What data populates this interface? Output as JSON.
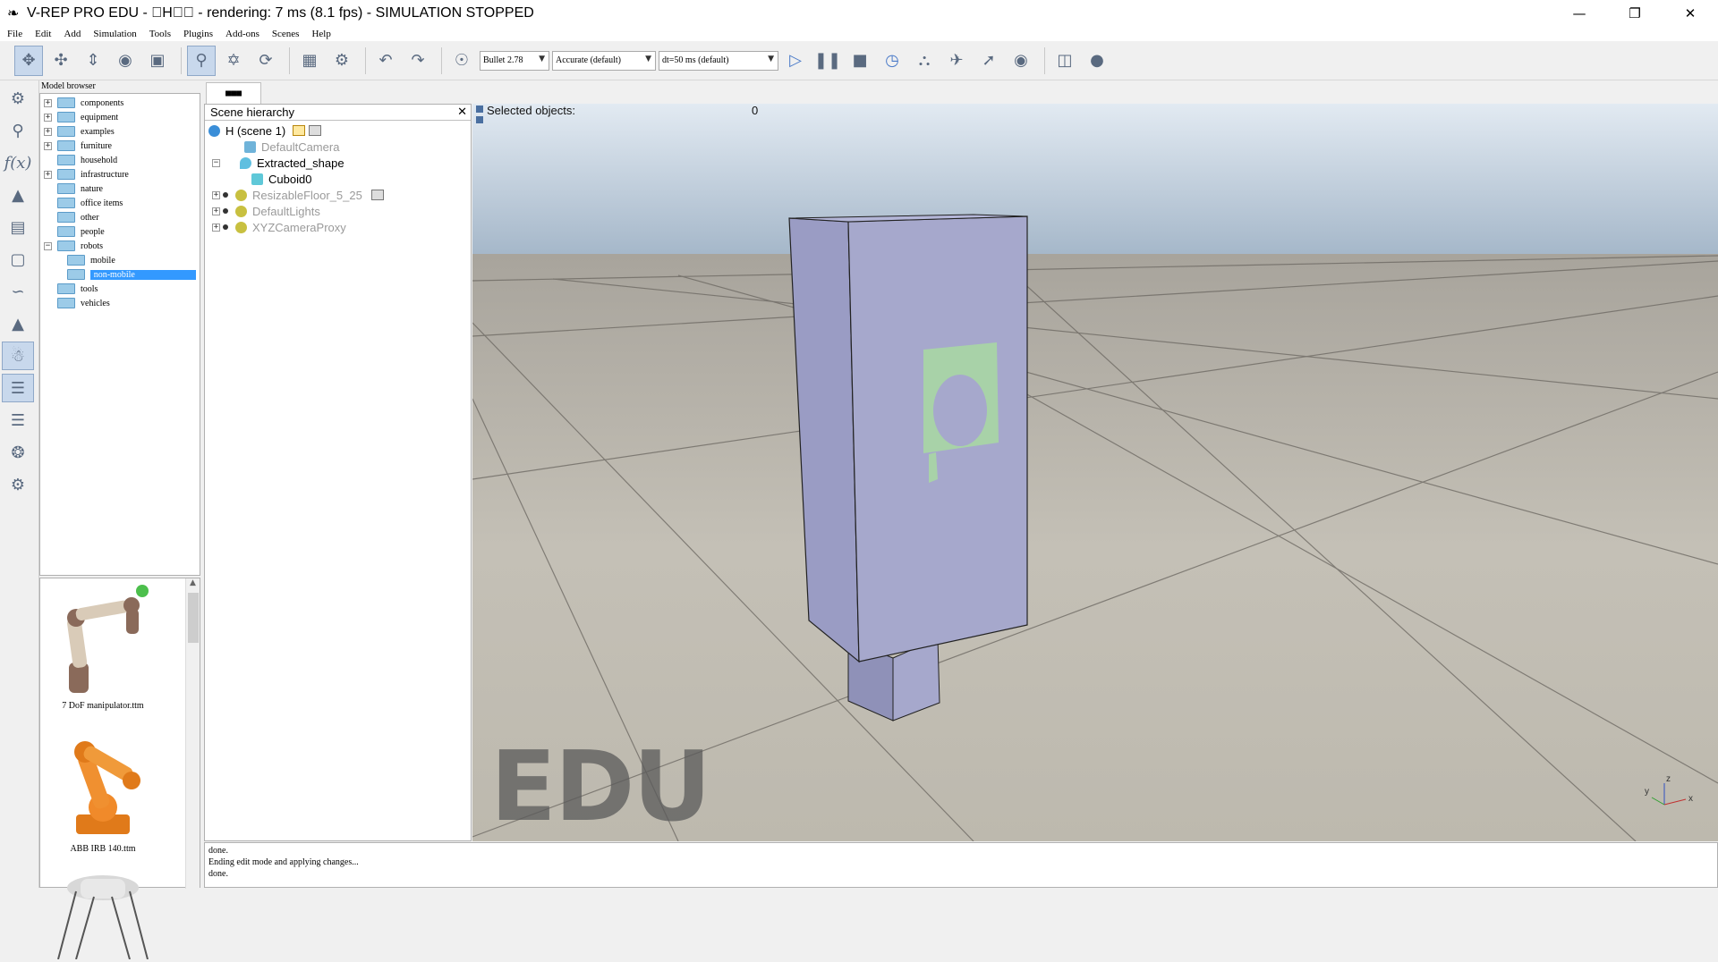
{
  "window": {
    "title": "V-REP PRO EDU - \u0000H\u0000\u0000 - rendering: 7 ms (8.1 fps) - SIMULATION STOPPED",
    "min_icon": "minimize-icon",
    "max_icon": "maximize-icon",
    "close_icon": "close-icon"
  },
  "menu": [
    "File",
    "Edit",
    "Add",
    "Simulation",
    "Tools",
    "Plugins",
    "Add-ons",
    "Scenes",
    "Help"
  ],
  "toolbar": {
    "engine": "Bullet 2.78",
    "accuracy": "Accurate (default)",
    "timestep": "dt=50 ms (default)"
  },
  "model_browser": {
    "title": "Model browser",
    "items": [
      {
        "label": "components",
        "expandable": true,
        "depth": 0
      },
      {
        "label": "equipment",
        "expandable": true,
        "depth": 0
      },
      {
        "label": "examples",
        "expandable": true,
        "depth": 0
      },
      {
        "label": "furniture",
        "expandable": true,
        "depth": 0
      },
      {
        "label": "household",
        "expandable": false,
        "depth": 0
      },
      {
        "label": "infrastructure",
        "expandable": true,
        "depth": 0
      },
      {
        "label": "nature",
        "expandable": false,
        "depth": 0
      },
      {
        "label": "office items",
        "expandable": false,
        "depth": 0
      },
      {
        "label": "other",
        "expandable": false,
        "depth": 0
      },
      {
        "label": "people",
        "expandable": false,
        "depth": 0
      },
      {
        "label": "robots",
        "expandable": true,
        "depth": 0
      },
      {
        "label": "mobile",
        "expandable": false,
        "depth": 1
      },
      {
        "label": "non-mobile",
        "expandable": false,
        "depth": 1
      },
      {
        "label": "tools",
        "expandable": false,
        "depth": 0
      },
      {
        "label": "vehicles",
        "expandable": false,
        "depth": 0
      }
    ],
    "thumbnails": [
      {
        "label": "7 DoF manipulator.ttm"
      },
      {
        "label": "ABB IRB 140.ttm"
      },
      {
        "label": ""
      }
    ]
  },
  "scene_tab": "■■■",
  "hierarchy": {
    "title": "Scene hierarchy",
    "rows": [
      {
        "label": "H (scene 1)",
        "dim": false
      },
      {
        "label": "DefaultCamera",
        "dim": true
      },
      {
        "label": "Extracted_shape",
        "dim": false
      },
      {
        "label": "Cuboid0",
        "dim": false
      },
      {
        "label": "ResizableFloor_5_25",
        "dim": true
      },
      {
        "label": "DefaultLights",
        "dim": true
      },
      {
        "label": "XYZCameraProxy",
        "dim": true
      }
    ]
  },
  "viewport": {
    "selected_label": "Selected objects:",
    "selected_count": "0",
    "watermark": "EDU",
    "axis_x": "x",
    "axis_y": "y",
    "axis_z": "z"
  },
  "console": [
    "done.",
    "Ending edit mode and applying changes...",
    "done."
  ],
  "colors": {
    "shape": "#a6a8cc",
    "shape_green": "#a8d2a8",
    "selection": "#3399ff"
  }
}
